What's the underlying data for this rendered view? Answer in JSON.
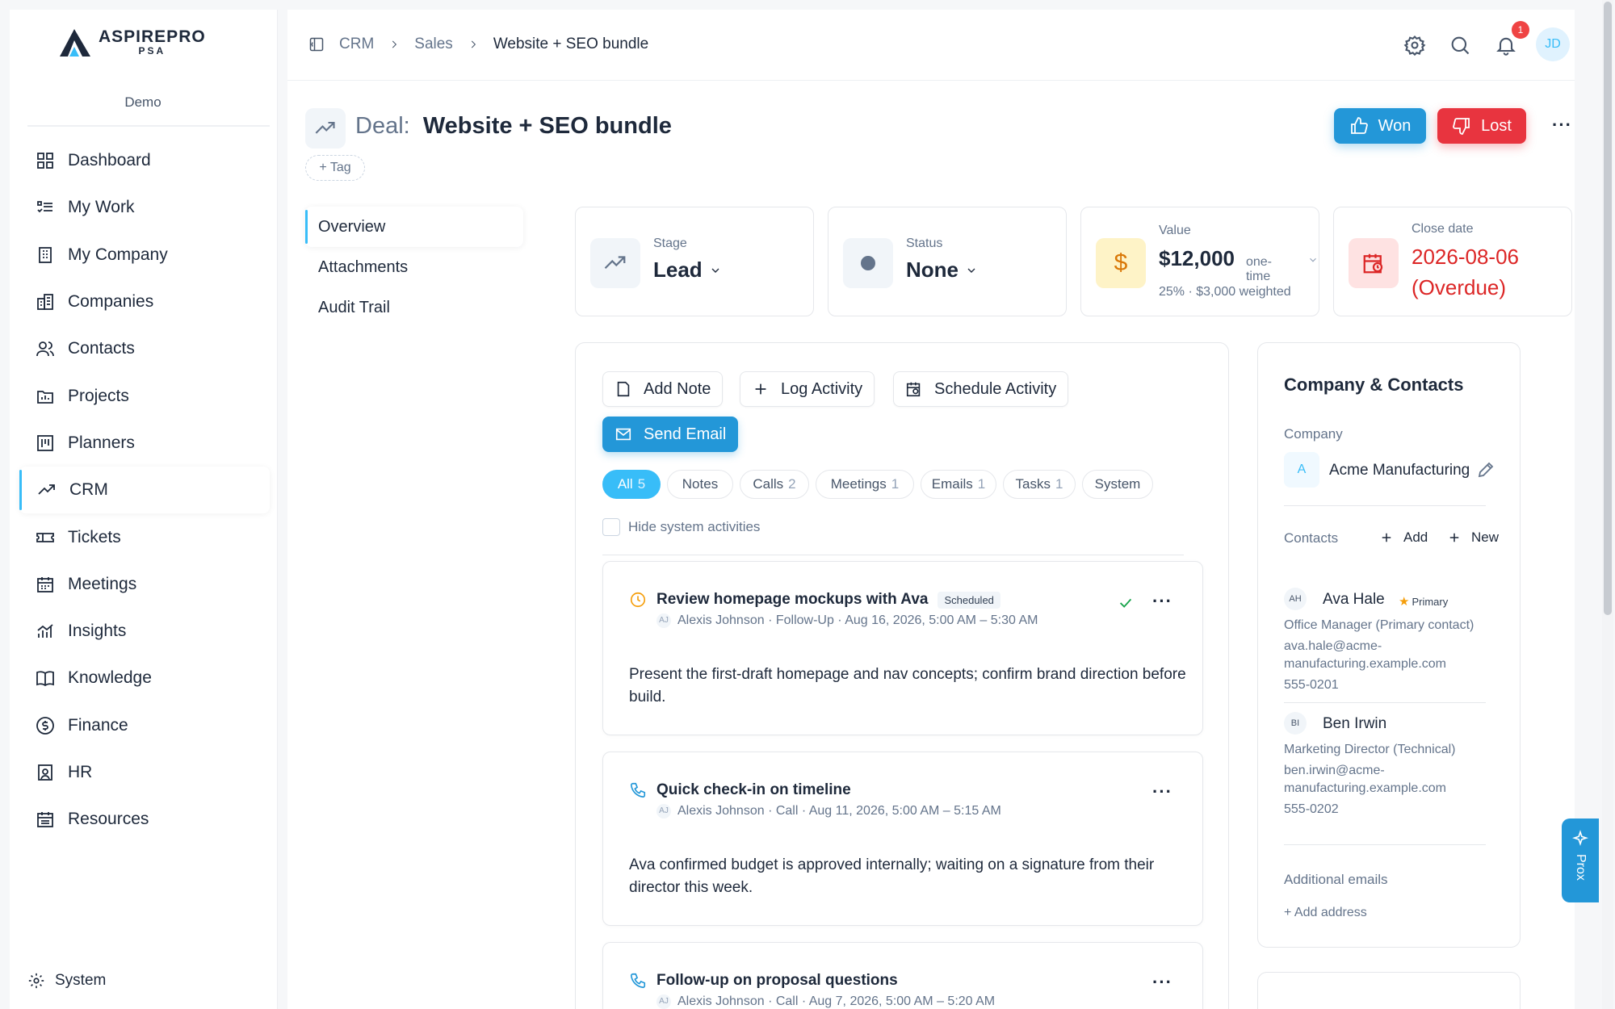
{
  "brand": {
    "name": "ASPIREPRO",
    "sub": "PSA",
    "org": "Demo"
  },
  "sidebar": {
    "items": [
      {
        "label": "Dashboard",
        "icon": "grid-icon"
      },
      {
        "label": "My Work",
        "icon": "list-check-icon"
      },
      {
        "label": "My Company",
        "icon": "building-icon"
      },
      {
        "label": "Companies",
        "icon": "buildings-icon"
      },
      {
        "label": "Contacts",
        "icon": "users-icon"
      },
      {
        "label": "Projects",
        "icon": "folder-icon"
      },
      {
        "label": "Planners",
        "icon": "kanban-icon"
      },
      {
        "label": "CRM",
        "icon": "trend-icon"
      },
      {
        "label": "Tickets",
        "icon": "ticket-icon"
      },
      {
        "label": "Meetings",
        "icon": "calendar-icon"
      },
      {
        "label": "Insights",
        "icon": "chart-icon"
      },
      {
        "label": "Knowledge",
        "icon": "book-icon"
      },
      {
        "label": "Finance",
        "icon": "dollar-icon"
      },
      {
        "label": "HR",
        "icon": "badge-icon"
      },
      {
        "label": "Resources",
        "icon": "calendar-grid-icon"
      }
    ],
    "active": "CRM",
    "system": "System"
  },
  "topbar": {
    "breadcrumb": [
      "CRM",
      "Sales",
      "Website + SEO bundle"
    ],
    "notifications": "1",
    "user_initials": "JD"
  },
  "deal": {
    "label": "Deal:",
    "name": "Website + SEO bundle",
    "tag_label": "+ Tag",
    "won_label": "Won",
    "lost_label": "Lost"
  },
  "subnav": [
    "Overview",
    "Attachments",
    "Audit Trail"
  ],
  "stats": {
    "stage": {
      "label": "Stage",
      "value": "Lead"
    },
    "status": {
      "label": "Status",
      "value": "None"
    },
    "value": {
      "label": "Value",
      "amount": "$12,000",
      "type": "one-time",
      "weighted": "25% · $3,000 weighted"
    },
    "close": {
      "label": "Close date",
      "date": "2026-08-06",
      "note": "(Overdue)"
    }
  },
  "actions": {
    "add_note": "Add Note",
    "log_activity": "Log Activity",
    "schedule_activity": "Schedule Activity",
    "send_email": "Send Email"
  },
  "filters": [
    {
      "label": "All",
      "count": "5"
    },
    {
      "label": "Notes",
      "count": ""
    },
    {
      "label": "Calls",
      "count": "2"
    },
    {
      "label": "Meetings",
      "count": "1"
    },
    {
      "label": "Emails",
      "count": "1"
    },
    {
      "label": "Tasks",
      "count": "1"
    },
    {
      "label": "System",
      "count": ""
    }
  ],
  "hide_system": "Hide system activities",
  "activities": [
    {
      "title": "Review homepage mockups with Ava",
      "badge": "Scheduled",
      "initials": "AJ",
      "meta": "Alexis Johnson · Follow-Up · Aug 16, 2026, 5:00 AM – 5:30 AM",
      "body": "Present the first-draft homepage and nav concepts; confirm brand direction before build."
    },
    {
      "title": "Quick check-in on timeline",
      "initials": "AJ",
      "meta": "Alexis Johnson · Call · Aug 11, 2026, 5:00 AM – 5:15 AM",
      "body": "Ava confirmed budget is approved internally; waiting on a signature from their director this week."
    },
    {
      "title": "Follow-up on proposal questions",
      "initials": "AJ",
      "meta": "Alexis Johnson · Call · Aug 7, 2026, 5:00 AM – 5:20 AM"
    }
  ],
  "company_panel": {
    "title": "Company & Contacts",
    "company_label": "Company",
    "company_initial": "A",
    "company_name": "Acme Manufacturing",
    "contacts_label": "Contacts",
    "add_label": "Add",
    "new_label": "New",
    "contacts": [
      {
        "initials": "AH",
        "name": "Ava Hale",
        "primary": "Primary",
        "role": "Office Manager (Primary contact)",
        "email1": "ava.hale@acme-",
        "email2": "manufacturing.example.com",
        "phone": "555-0201"
      },
      {
        "initials": "BI",
        "name": "Ben Irwin",
        "role": "Marketing Director (Technical)",
        "email1": "ben.irwin@acme-",
        "email2": "manufacturing.example.com",
        "phone": "555-0202"
      }
    ],
    "additional_emails": "Additional emails",
    "add_address": "+ Add address"
  },
  "ai_tab": "Prox",
  "colors": {
    "accent": "#2397d8",
    "danger": "#e8343f",
    "overdue": "#dc2626",
    "value": "#d97706"
  }
}
